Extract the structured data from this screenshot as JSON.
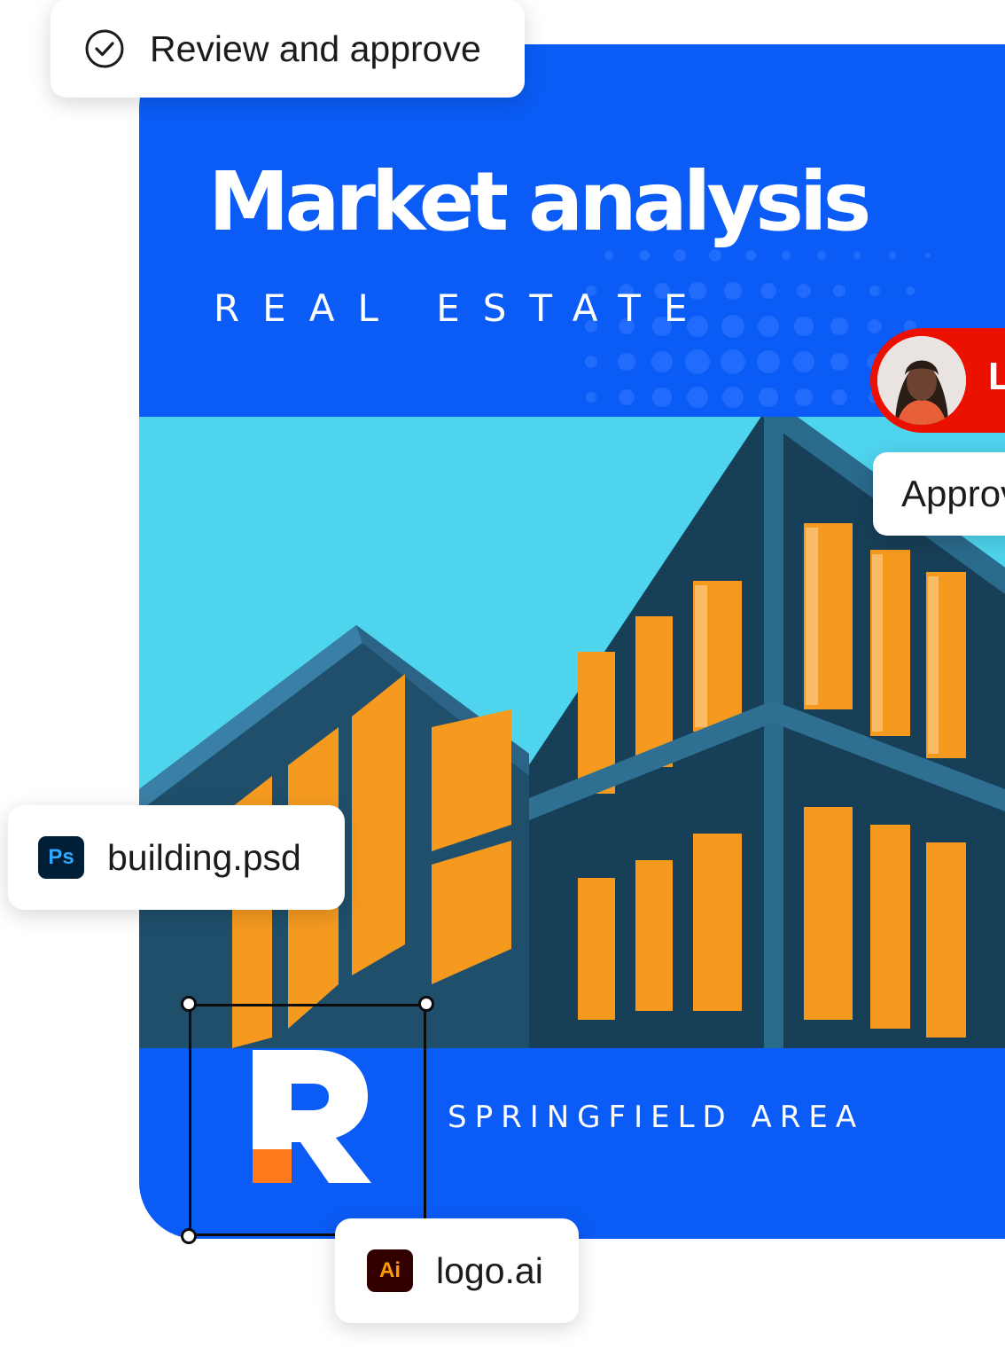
{
  "review_chip": {
    "icon": "check-circle-icon",
    "label": "Review and approve"
  },
  "poster": {
    "title": "Market analysis",
    "subtitle": "REAL ESTATE",
    "area": "SPRINGFIELD AREA",
    "logo_letter": "R",
    "colors": {
      "background": "#0b5cf6",
      "sky": "#4fd4ee",
      "facade": "#1f4f6b",
      "window_glow": "#f59a1f",
      "logo_accent": "#ff7a1a"
    }
  },
  "files": [
    {
      "badge": "Ps",
      "name": "building.psd",
      "icon": "photoshop-icon"
    },
    {
      "badge": "Ai",
      "name": "logo.ai",
      "icon": "illustrator-icon"
    }
  ],
  "reviewer": {
    "initial": "L",
    "status": "Approv",
    "accent": "#eb1000"
  },
  "colors": {
    "accent": "#0b5cf6",
    "approve_red": "#eb1000"
  }
}
